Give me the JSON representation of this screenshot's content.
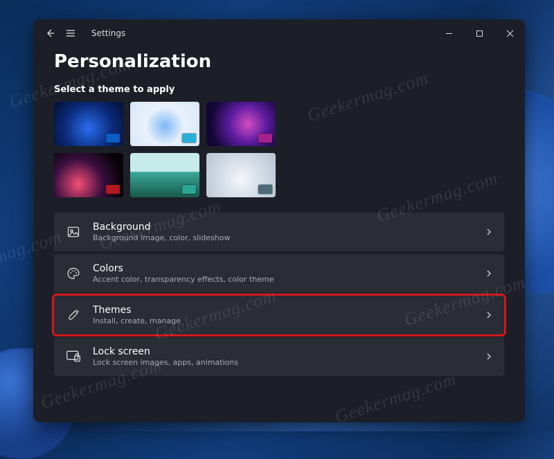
{
  "watermark_text": "Geekermag.com",
  "header": {
    "app_name": "Settings",
    "page_title": "Personalization"
  },
  "themes": {
    "section_label": "Select a theme to apply",
    "tiles": [
      {
        "name": "windows-dark-blue",
        "accent": "#0b5cc4"
      },
      {
        "name": "windows-light-blue",
        "accent": "#29b0d9"
      },
      {
        "name": "glow-purple",
        "accent": "#a5218c"
      },
      {
        "name": "flow-dark-red",
        "accent": "#b1191f"
      },
      {
        "name": "captured-motion",
        "accent": "#2aa591"
      },
      {
        "name": "sunrise-light",
        "accent": "#4c6a78"
      }
    ]
  },
  "list_items": [
    {
      "key": "background",
      "icon": "image-icon",
      "title": "Background",
      "subtitle": "Background image, color, slideshow",
      "highlight": false
    },
    {
      "key": "colors",
      "icon": "palette-icon",
      "title": "Colors",
      "subtitle": "Accent color, transparency effects, color theme",
      "highlight": false
    },
    {
      "key": "themes",
      "icon": "paintbrush-icon",
      "title": "Themes",
      "subtitle": "Install, create, manage",
      "highlight": true
    },
    {
      "key": "lock-screen",
      "icon": "lock-screen-icon",
      "title": "Lock screen",
      "subtitle": "Lock screen images, apps, animations",
      "highlight": false
    }
  ]
}
